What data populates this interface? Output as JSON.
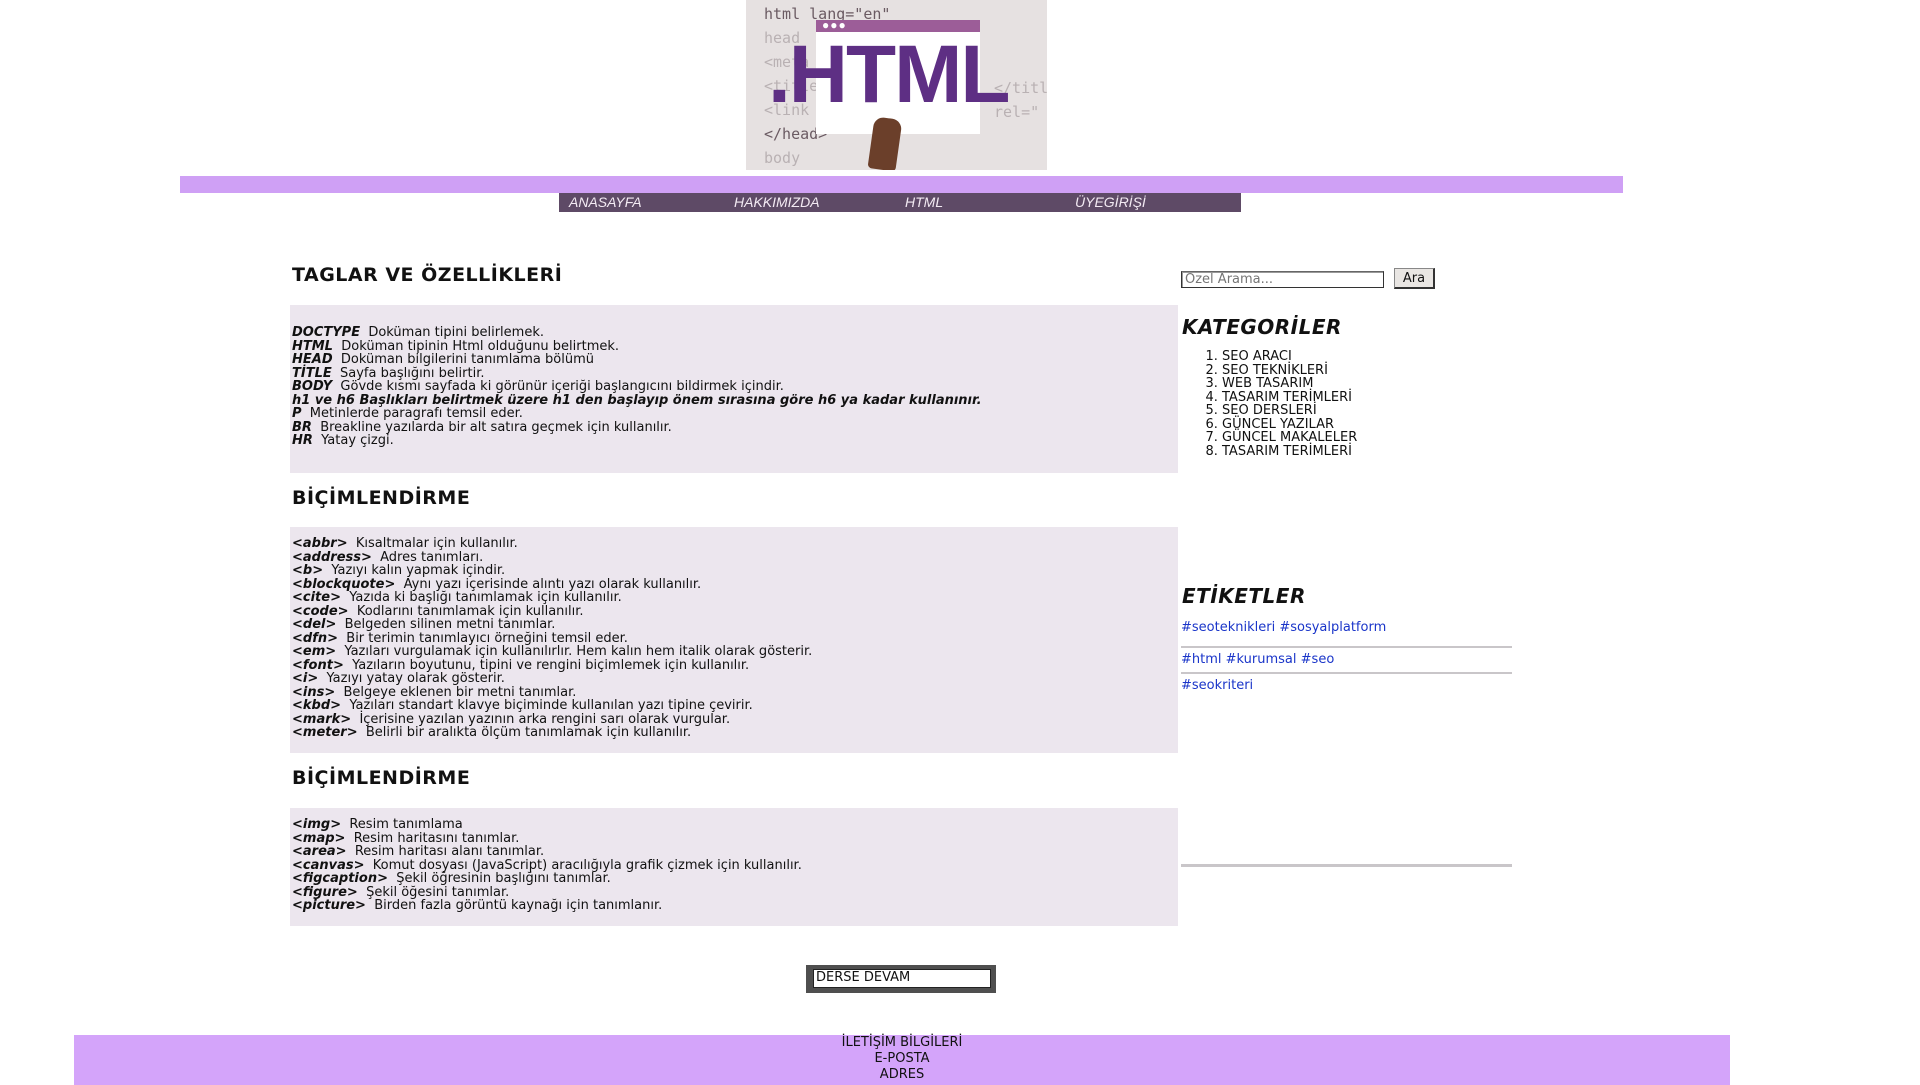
{
  "header": {
    "logo_text": ".HTML",
    "code_lines": [
      "html lang=\"en\"",
      "head",
      "<meta",
      "<title",
      "<link",
      "</head>",
      "body"
    ],
    "code_right": [
      "</title",
      "rel=\""
    ]
  },
  "nav": {
    "items": [
      "ANASAYFA",
      "HAKKIMIZDA",
      "HTML",
      "ÜYEGİRİŞİ"
    ]
  },
  "sections": [
    {
      "title": "TAGLAR VE ÖZELLİKLERİ",
      "rows": [
        {
          "tag": "DOCTYPE",
          "desc": "Doküman tipini belirlemek."
        },
        {
          "tag": "HTML",
          "desc": "Doküman tipinin Html olduğunu belirtmek."
        },
        {
          "tag": "HEAD",
          "desc": "Doküman bilgilerini tanımlama bölümü"
        },
        {
          "tag": "TİTLE",
          "desc": "Sayfa başlığını belirtir."
        },
        {
          "tag": "BODY",
          "desc": "Gövde kısmı sayfada ki görünür içeriği başlangıcını bildirmek içindir."
        },
        {
          "tag": "h1 ve h6 Başlıkları belirtmek üzere h1 den başlayıp önem sırasına göre h6 ya kadar kullanınır.",
          "desc": ""
        },
        {
          "tag": "P",
          "desc": "Metinlerde paragrafı temsil eder."
        },
        {
          "tag": "BR",
          "desc": "Breakline yazılarda bir alt satıra geçmek için kullanılır."
        },
        {
          "tag": "HR",
          "desc": "Yatay çizgi."
        }
      ]
    },
    {
      "title": "BİÇİMLENDİRME",
      "rows": [
        {
          "tag": "<abbr>",
          "desc": "Kısaltmalar için kullanılır."
        },
        {
          "tag": "<address>",
          "desc": "Adres tanımları."
        },
        {
          "tag": "<b>",
          "desc": "Yazıyı kalın yapmak içindir."
        },
        {
          "tag": "<blockquote>",
          "desc": "Aynı yazı içerisinde alıntı yazı olarak kullanılır."
        },
        {
          "tag": "<cite>",
          "desc": "Yazıda ki başlığı tanımlamak için kullanılır."
        },
        {
          "tag": "<code>",
          "desc": "Kodlarını tanımlamak için kullanılır."
        },
        {
          "tag": "<del>",
          "desc": "Belgeden silinen metni tanımlar."
        },
        {
          "tag": "<dfn>",
          "desc": "Bir terimin tanımlayıcı örneğini temsil eder."
        },
        {
          "tag": "<em>",
          "desc": "Yazıları vurgulamak için kullanılırlır. Hem kalın hem italik olarak gösterir."
        },
        {
          "tag": "<font>",
          "desc": "Yazıların boyutunu, tipini ve rengini biçimlemek için kullanılır."
        },
        {
          "tag": "<i>",
          "desc": "Yazıyı yatay olarak gösterir."
        },
        {
          "tag": "<ins>",
          "desc": "Belgeye eklenen bir metni tanımlar."
        },
        {
          "tag": "<kbd>",
          "desc": "Yazıları standart klavye biçiminde kullanılan yazı tipine çevirir."
        },
        {
          "tag": "<mark>",
          "desc": "İçerisine yazılan yazının arka rengini sarı olarak vurgular."
        },
        {
          "tag": "<meter>",
          "desc": "Belirli bir aralıkta ölçüm tanımlamak için kullanılır."
        }
      ]
    },
    {
      "title": "BİÇİMLENDİRME",
      "rows": [
        {
          "tag": "<img>",
          "desc": "Resim tanımlama"
        },
        {
          "tag": "<map>",
          "desc": "Resim haritasını tanımlar."
        },
        {
          "tag": "<area>",
          "desc": "Resim haritası alanı tanımlar."
        },
        {
          "tag": "<canvas>",
          "desc": "Komut dosyası (JavaScript) aracılığıyla grafik çizmek için kullanılır."
        },
        {
          "tag": "<figcaption>",
          "desc": "Şekil öğresinin başlığını tanımlar."
        },
        {
          "tag": "<figure>",
          "desc": "Şekil öğesini tanımlar."
        },
        {
          "tag": "<picture>",
          "desc": "Birden fazla görüntü kaynağı için tanımlanır."
        }
      ]
    }
  ],
  "search": {
    "placeholder": "Özel Arama...",
    "button_label": "Ara"
  },
  "categories": {
    "title": "KATEGORİLER",
    "items": [
      "SEO ARACI",
      "SEO TEKNİKLERİ",
      "WEB TASARIM",
      "TASARIM TERİMLERİ",
      "SEO DERSLERİ",
      "GÜNCEL YAZILAR",
      "GÜNCEL MAKALELER",
      "TASARIM TERİMLERİ"
    ]
  },
  "tags": {
    "title": "ETİKETLER",
    "lines": [
      [
        "#seoteknikleri",
        "#sosyalplatform"
      ],
      [
        "#html",
        "#kurumsal",
        "#seo"
      ],
      [
        "#seokriteri"
      ]
    ]
  },
  "continue_button": "DERSE DEVAM",
  "footer": {
    "lines": [
      "İLETİŞİM BİLGİLERİ",
      "E-POSTA",
      "ADRES"
    ]
  },
  "colors": {
    "accent_bar": "#cfa0f5",
    "nav_bg": "#5e4a66",
    "content_box": "#ece6ee",
    "footer_bg": "#d4a4fa",
    "tag_link": "#1a35c9",
    "logo_purple": "#5e2f84"
  }
}
